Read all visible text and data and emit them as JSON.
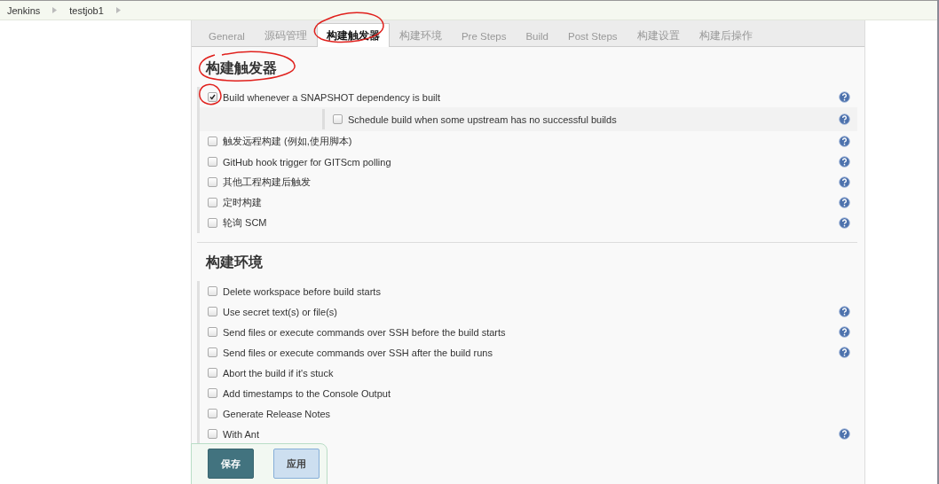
{
  "breadcrumbs": [
    {
      "label": "Jenkins"
    },
    {
      "label": "testjob1"
    }
  ],
  "tabs": [
    {
      "label": "General",
      "selected": false
    },
    {
      "label": "源码管理",
      "selected": false
    },
    {
      "label": "构建触发器",
      "selected": true
    },
    {
      "label": "构建环境",
      "selected": false
    },
    {
      "label": "Pre Steps",
      "selected": false
    },
    {
      "label": "Build",
      "selected": false
    },
    {
      "label": "Post Steps",
      "selected": false
    },
    {
      "label": "构建设置",
      "selected": false
    },
    {
      "label": "构建后操作",
      "selected": false
    }
  ],
  "sections": [
    {
      "title": "构建触发器",
      "options": [
        {
          "label": "Build whenever a SNAPSHOT dependency is built",
          "checked": true,
          "help": true,
          "children": [
            {
              "label": "Schedule build when some upstream has no successful builds",
              "checked": false,
              "help": true
            }
          ]
        },
        {
          "label": "触发远程构建 (例如,使用脚本)",
          "checked": false,
          "help": true
        },
        {
          "label": "GitHub hook trigger for GITScm polling",
          "checked": false,
          "help": true
        },
        {
          "label": "其他工程构建后触发",
          "checked": false,
          "help": true
        },
        {
          "label": "定时构建",
          "checked": false,
          "help": true
        },
        {
          "label": "轮询 SCM",
          "checked": false,
          "help": true
        }
      ]
    },
    {
      "title": "构建环境",
      "options": [
        {
          "label": "Delete workspace before build starts",
          "checked": false,
          "help": false
        },
        {
          "label": "Use secret text(s) or file(s)",
          "checked": false,
          "help": true
        },
        {
          "label": "Send files or execute commands over SSH before the build starts",
          "checked": false,
          "help": true
        },
        {
          "label": "Send files or execute commands over SSH after the build runs",
          "checked": false,
          "help": true
        },
        {
          "label": "Abort the build if it's stuck",
          "checked": false,
          "help": false
        },
        {
          "label": "Add timestamps to the Console Output",
          "checked": false,
          "help": false
        },
        {
          "label": "Generate Release Notes",
          "checked": false,
          "help": false
        },
        {
          "label": "With Ant",
          "checked": false,
          "help": true
        }
      ]
    }
  ],
  "actions": [
    {
      "label": "保存",
      "kind": "primary"
    },
    {
      "label": "应用",
      "kind": "secondary"
    }
  ]
}
